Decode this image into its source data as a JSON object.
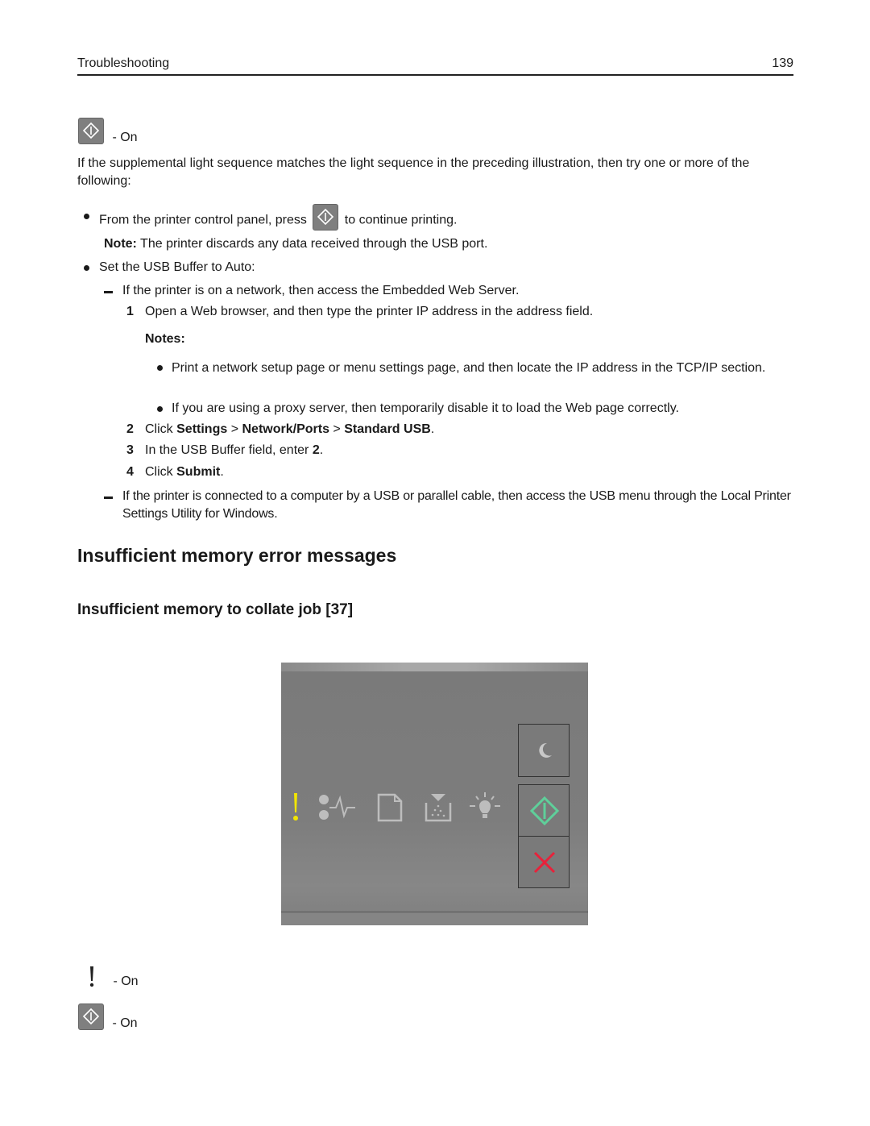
{
  "header": {
    "section": "Troubleshooting",
    "page_number": "139"
  },
  "top_indicator": {
    "icon": "start-button-icon",
    "state": "- On"
  },
  "intro": "If the supplemental light sequence matches the light sequence in the preceding illustration, then try one or more of the following:",
  "bullets": [
    {
      "text_before": "From the printer control panel, press",
      "icon": "start-button-icon",
      "text_after": "to continue printing.",
      "note_label": "Note:",
      "note_text": "The printer discards any data received through the USB port."
    },
    {
      "text": "Set the USB Buffer to Auto:",
      "sub_items": [
        {
          "text": "If the printer is on a network, then access the Embedded Web Server.",
          "steps": [
            {
              "num": "1",
              "text": "Open a Web browser, and then type the printer IP address in the address field.",
              "notes_label": "Notes:",
              "notes": [
                "Print a network setup page or menu settings page, and then locate the IP address in the TCP/IP section.",
                "If you are using a proxy server, then temporarily disable it to load the Web page correctly."
              ]
            },
            {
              "num": "2",
              "prefix": "Click",
              "path": [
                "Settings",
                "Network/Ports",
                "Standard USB"
              ],
              "separator": ">",
              "suffix": "."
            },
            {
              "num": "3",
              "prefix": "In the USB Buffer field, enter",
              "value": "2",
              "suffix": "."
            },
            {
              "num": "4",
              "prefix": "Click",
              "bold": "Submit",
              "suffix": "."
            }
          ]
        },
        {
          "text": "If the printer is connected to a computer by a USB or parallel cable, then access the USB menu through the Local Printer Settings Utility for Windows."
        }
      ]
    }
  ],
  "section_title": "Insufficient memory error messages",
  "subsection_title": "Insufficient memory to collate job [37]",
  "panel": {
    "lights": [
      {
        "name": "error",
        "icon": "exclamation-icon",
        "state": "on",
        "color": "#f2e600"
      },
      {
        "name": "paper-jam",
        "icon": "paper-jam-icon",
        "state": "off"
      },
      {
        "name": "load-paper",
        "icon": "paper-icon",
        "state": "off"
      },
      {
        "name": "toner",
        "icon": "toner-icon",
        "state": "off"
      },
      {
        "name": "ready",
        "icon": "lightbulb-icon",
        "state": "off"
      }
    ],
    "buttons": [
      {
        "name": "sleep",
        "icon": "moon-icon",
        "color": "#c8c8c8"
      },
      {
        "name": "start",
        "icon": "start-diamond-icon",
        "color": "#5fcf9a"
      },
      {
        "name": "cancel",
        "icon": "cancel-x-icon",
        "color": "#e8213a"
      }
    ]
  },
  "legend": [
    {
      "icon": "exclamation-icon",
      "state": "- On"
    },
    {
      "icon": "start-button-icon",
      "state": "- On"
    }
  ]
}
